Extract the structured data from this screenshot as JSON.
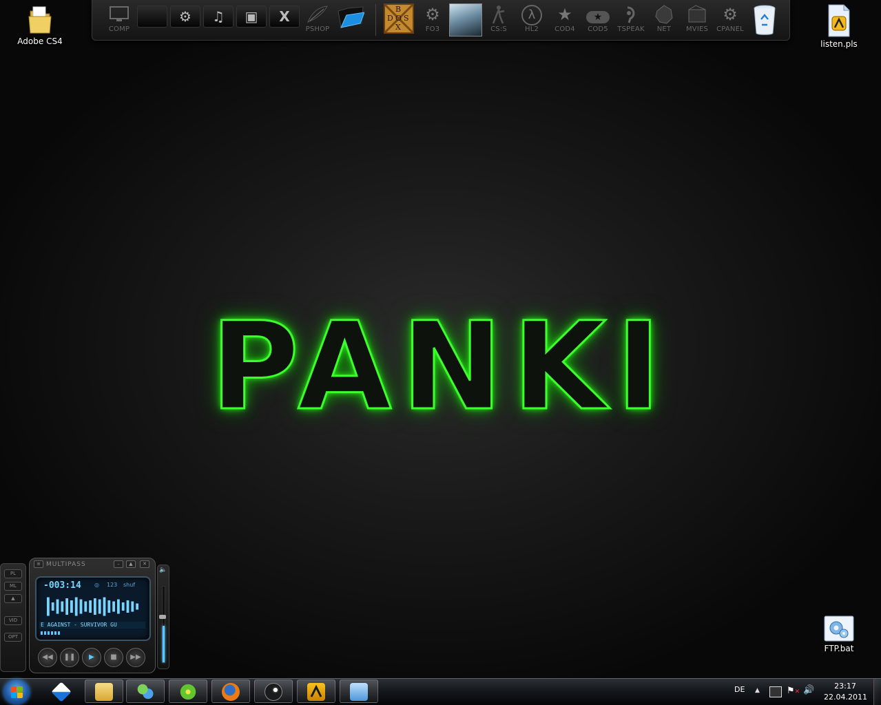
{
  "desktop": {
    "icons": [
      {
        "label": "Adobe CS4",
        "icon": "folder-icon"
      },
      {
        "label": "listen.pls",
        "icon": "playlist-file-icon"
      },
      {
        "label": "FTP.bat",
        "icon": "batch-file-icon"
      }
    ],
    "wallpaper_text": "PANKI",
    "wallpaper_color": "#3dff2e"
  },
  "dock": {
    "items": [
      {
        "label": "COMP",
        "icon": "monitor-icon"
      },
      {
        "label": "",
        "icon": "black-folder-icon"
      },
      {
        "label": "",
        "icon": "gears-folder-icon"
      },
      {
        "label": "",
        "icon": "music-folder-icon"
      },
      {
        "label": "",
        "icon": "camera-folder-icon"
      },
      {
        "label": "",
        "icon": "x-folder-icon"
      },
      {
        "label": "PSHOP",
        "icon": "feather-icon"
      },
      {
        "label": "",
        "icon": "blue-folder-icon"
      },
      {
        "label": "",
        "icon": "dosbox-icon",
        "box_text": [
          "B",
          "D",
          "O",
          "S",
          "X"
        ]
      },
      {
        "label": "FO3",
        "icon": "gear-emblem-icon"
      },
      {
        "label": "",
        "icon": "crysis-icon"
      },
      {
        "label": "CS:S",
        "icon": "soldier-icon"
      },
      {
        "label": "HL2",
        "icon": "lambda-icon"
      },
      {
        "label": "COD4",
        "icon": "star-4-icon"
      },
      {
        "label": "COD5",
        "icon": "star-ticket-icon"
      },
      {
        "label": "TSPEAK",
        "icon": "teamspeak-icon"
      },
      {
        "label": "NET",
        "icon": "network-icon"
      },
      {
        "label": "MVIES",
        "icon": "film-icon"
      },
      {
        "label": "CPANEL",
        "icon": "settings-gears-icon"
      },
      {
        "label": "",
        "icon": "recycle-bin-icon"
      }
    ]
  },
  "winamp": {
    "title": "MULTIPASS",
    "time": "-003:14",
    "mini_labels": [
      "◎",
      "123",
      "shuf"
    ],
    "song": "E AGAINST - SURVIVOR GU",
    "side_buttons": [
      "PL",
      "ML",
      "▲",
      "VID",
      "OPT"
    ],
    "controls": [
      "prev",
      "pause",
      "play",
      "stop",
      "next"
    ],
    "bar_levels": [
      0.9,
      0.4,
      0.7,
      0.5,
      0.8,
      0.6,
      0.9,
      0.7,
      0.5,
      0.6,
      0.8,
      0.7,
      0.9,
      0.6,
      0.5,
      0.7,
      0.4,
      0.6,
      0.5,
      0.3
    ],
    "accent": "#79d4ff"
  },
  "taskbar": {
    "buttons": [
      {
        "icon": "windows-live-icon",
        "active": false
      },
      {
        "icon": "explorer-icon",
        "active": true
      },
      {
        "icon": "messenger-icon",
        "active": true
      },
      {
        "icon": "icq-icon",
        "active": true
      },
      {
        "icon": "firefox-icon",
        "active": true
      },
      {
        "icon": "steam-icon",
        "active": true
      },
      {
        "icon": "winamp-icon",
        "active": true
      },
      {
        "icon": "control-panel-icon",
        "active": true
      }
    ],
    "language": "DE",
    "time": "23:17",
    "date": "22.04.2011"
  }
}
